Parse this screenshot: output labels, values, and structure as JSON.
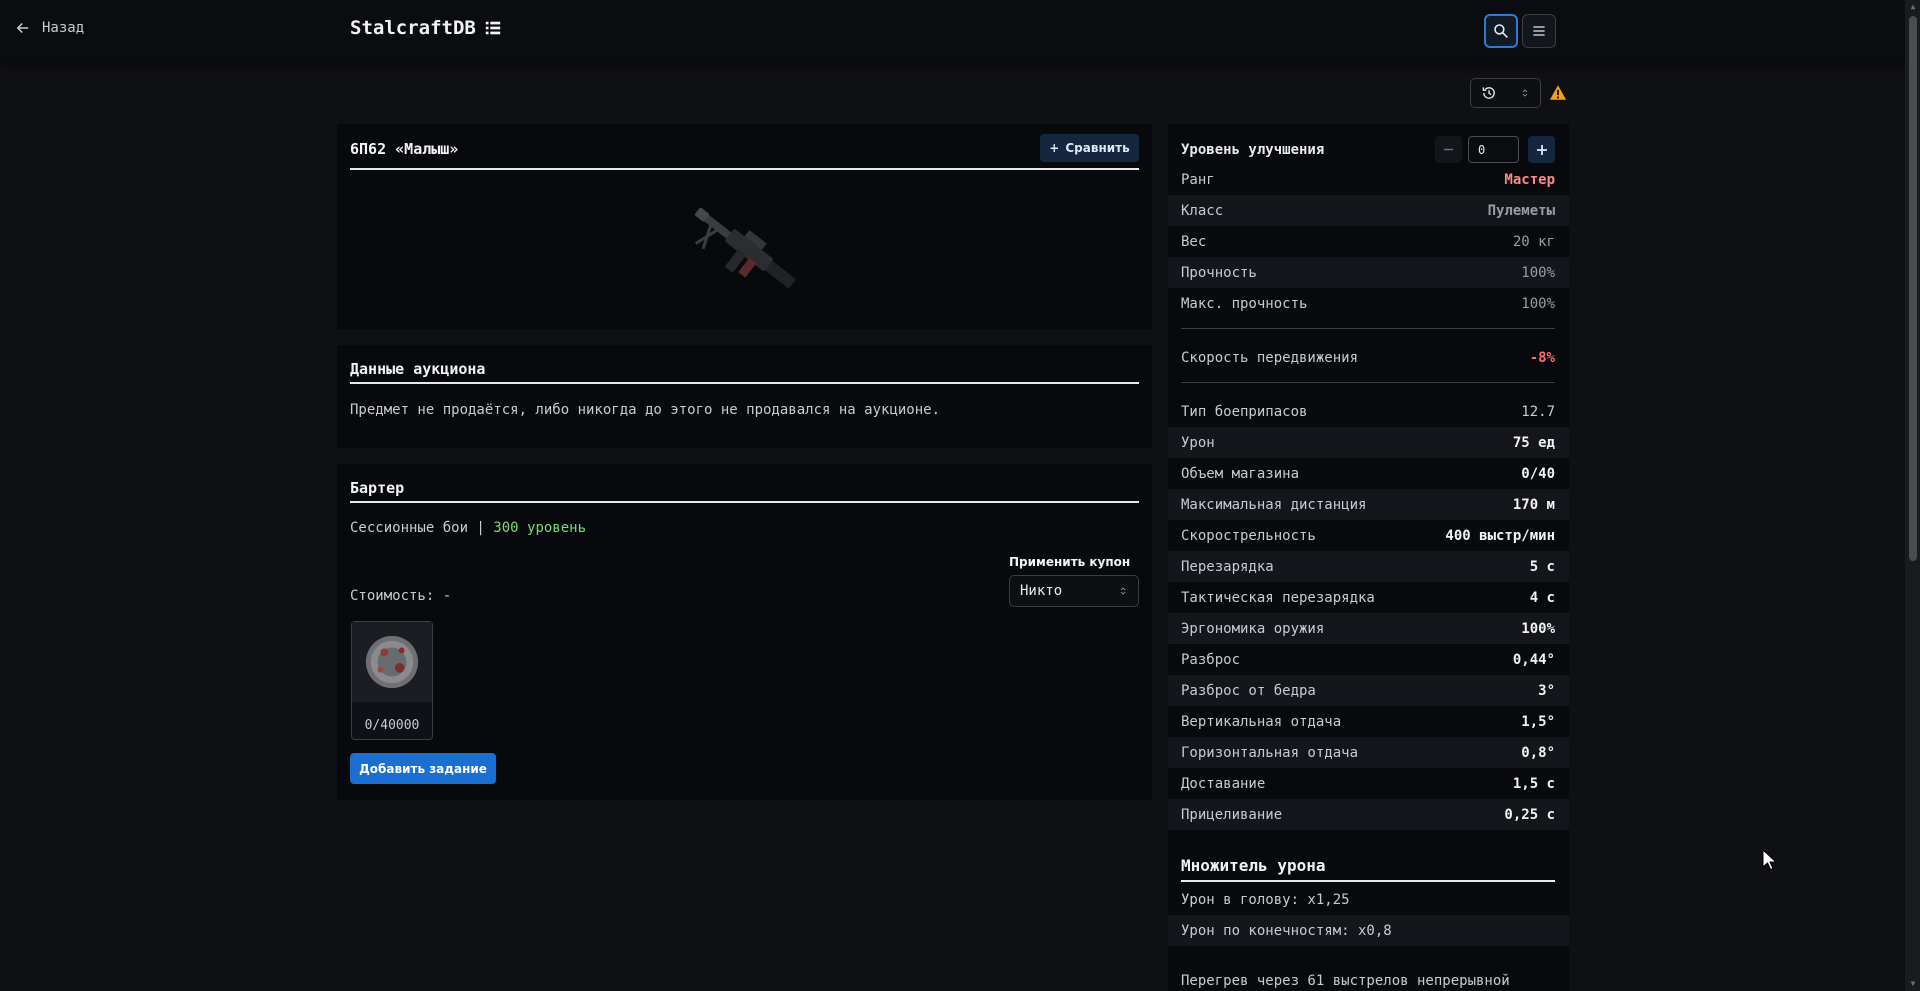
{
  "nav": {
    "back_label": "Назад",
    "brand": "StalcraftDB"
  },
  "item": {
    "name": "6П62 «Малыш»",
    "compare_label": "Сравнить"
  },
  "auction": {
    "title": "Данные аукциона",
    "text": "Предмет не продаётся, либо никогда до этого не продавался на аукционе."
  },
  "barter": {
    "title": "Бартер",
    "source": "Сессионные бои |",
    "level": "300 уровень",
    "coupon_label": "Применить купон",
    "coupon_value": "Никто",
    "cost_label": "Стоимость: -",
    "item_qty": "0/40000",
    "add_task_label": "Добавить задание"
  },
  "upgrade": {
    "label": "Уровень улучшения",
    "value": "0"
  },
  "stats": [
    {
      "key": "Ранг",
      "value": "Мастер"
    },
    {
      "key": "Класс",
      "value": "Пулеметы"
    },
    {
      "key": "Вес",
      "value": "20 кг"
    },
    {
      "key": "Прочность",
      "value": "100%"
    },
    {
      "key": "Макс. прочность",
      "value": "100%"
    },
    {
      "key": "Скорость передвижения",
      "value": "-8%"
    },
    {
      "key": "Тип боеприпасов",
      "value": "12.7"
    },
    {
      "key": "Урон",
      "value": "75 ед"
    },
    {
      "key": "Объем магазина",
      "value": "0/40"
    },
    {
      "key": "Максимальная дистанция",
      "value": "170 м"
    },
    {
      "key": "Скорострельность",
      "value": "400 выстр/мин"
    },
    {
      "key": "Перезарядка",
      "value": "5 с"
    },
    {
      "key": "Тактическая перезарядка",
      "value": "4 с"
    },
    {
      "key": "Эргономика оружия",
      "value": "100%"
    },
    {
      "key": "Разброс",
      "value": "0,44°"
    },
    {
      "key": "Разброс от бедра",
      "value": "3°"
    },
    {
      "key": "Вертикальная отдача",
      "value": "1,5°"
    },
    {
      "key": "Горизонтальная отдача",
      "value": "0,8°"
    },
    {
      "key": "Доставание",
      "value": "1,5 с"
    },
    {
      "key": "Прицеливание",
      "value": "0,25 с"
    }
  ],
  "multiplier": {
    "title": "Множитель урона",
    "head": "Урон в голову: x1,25",
    "limbs": "Урон по конечностям: x0,8",
    "overheat": "Перегрев через 61 выстрелов непрерывной"
  },
  "colors": {
    "accent": "#1a6fd1",
    "rank": "#ff8a8a",
    "negative": "#ff6b6b",
    "level": "#7dd87a",
    "warning": "#f0a020"
  }
}
